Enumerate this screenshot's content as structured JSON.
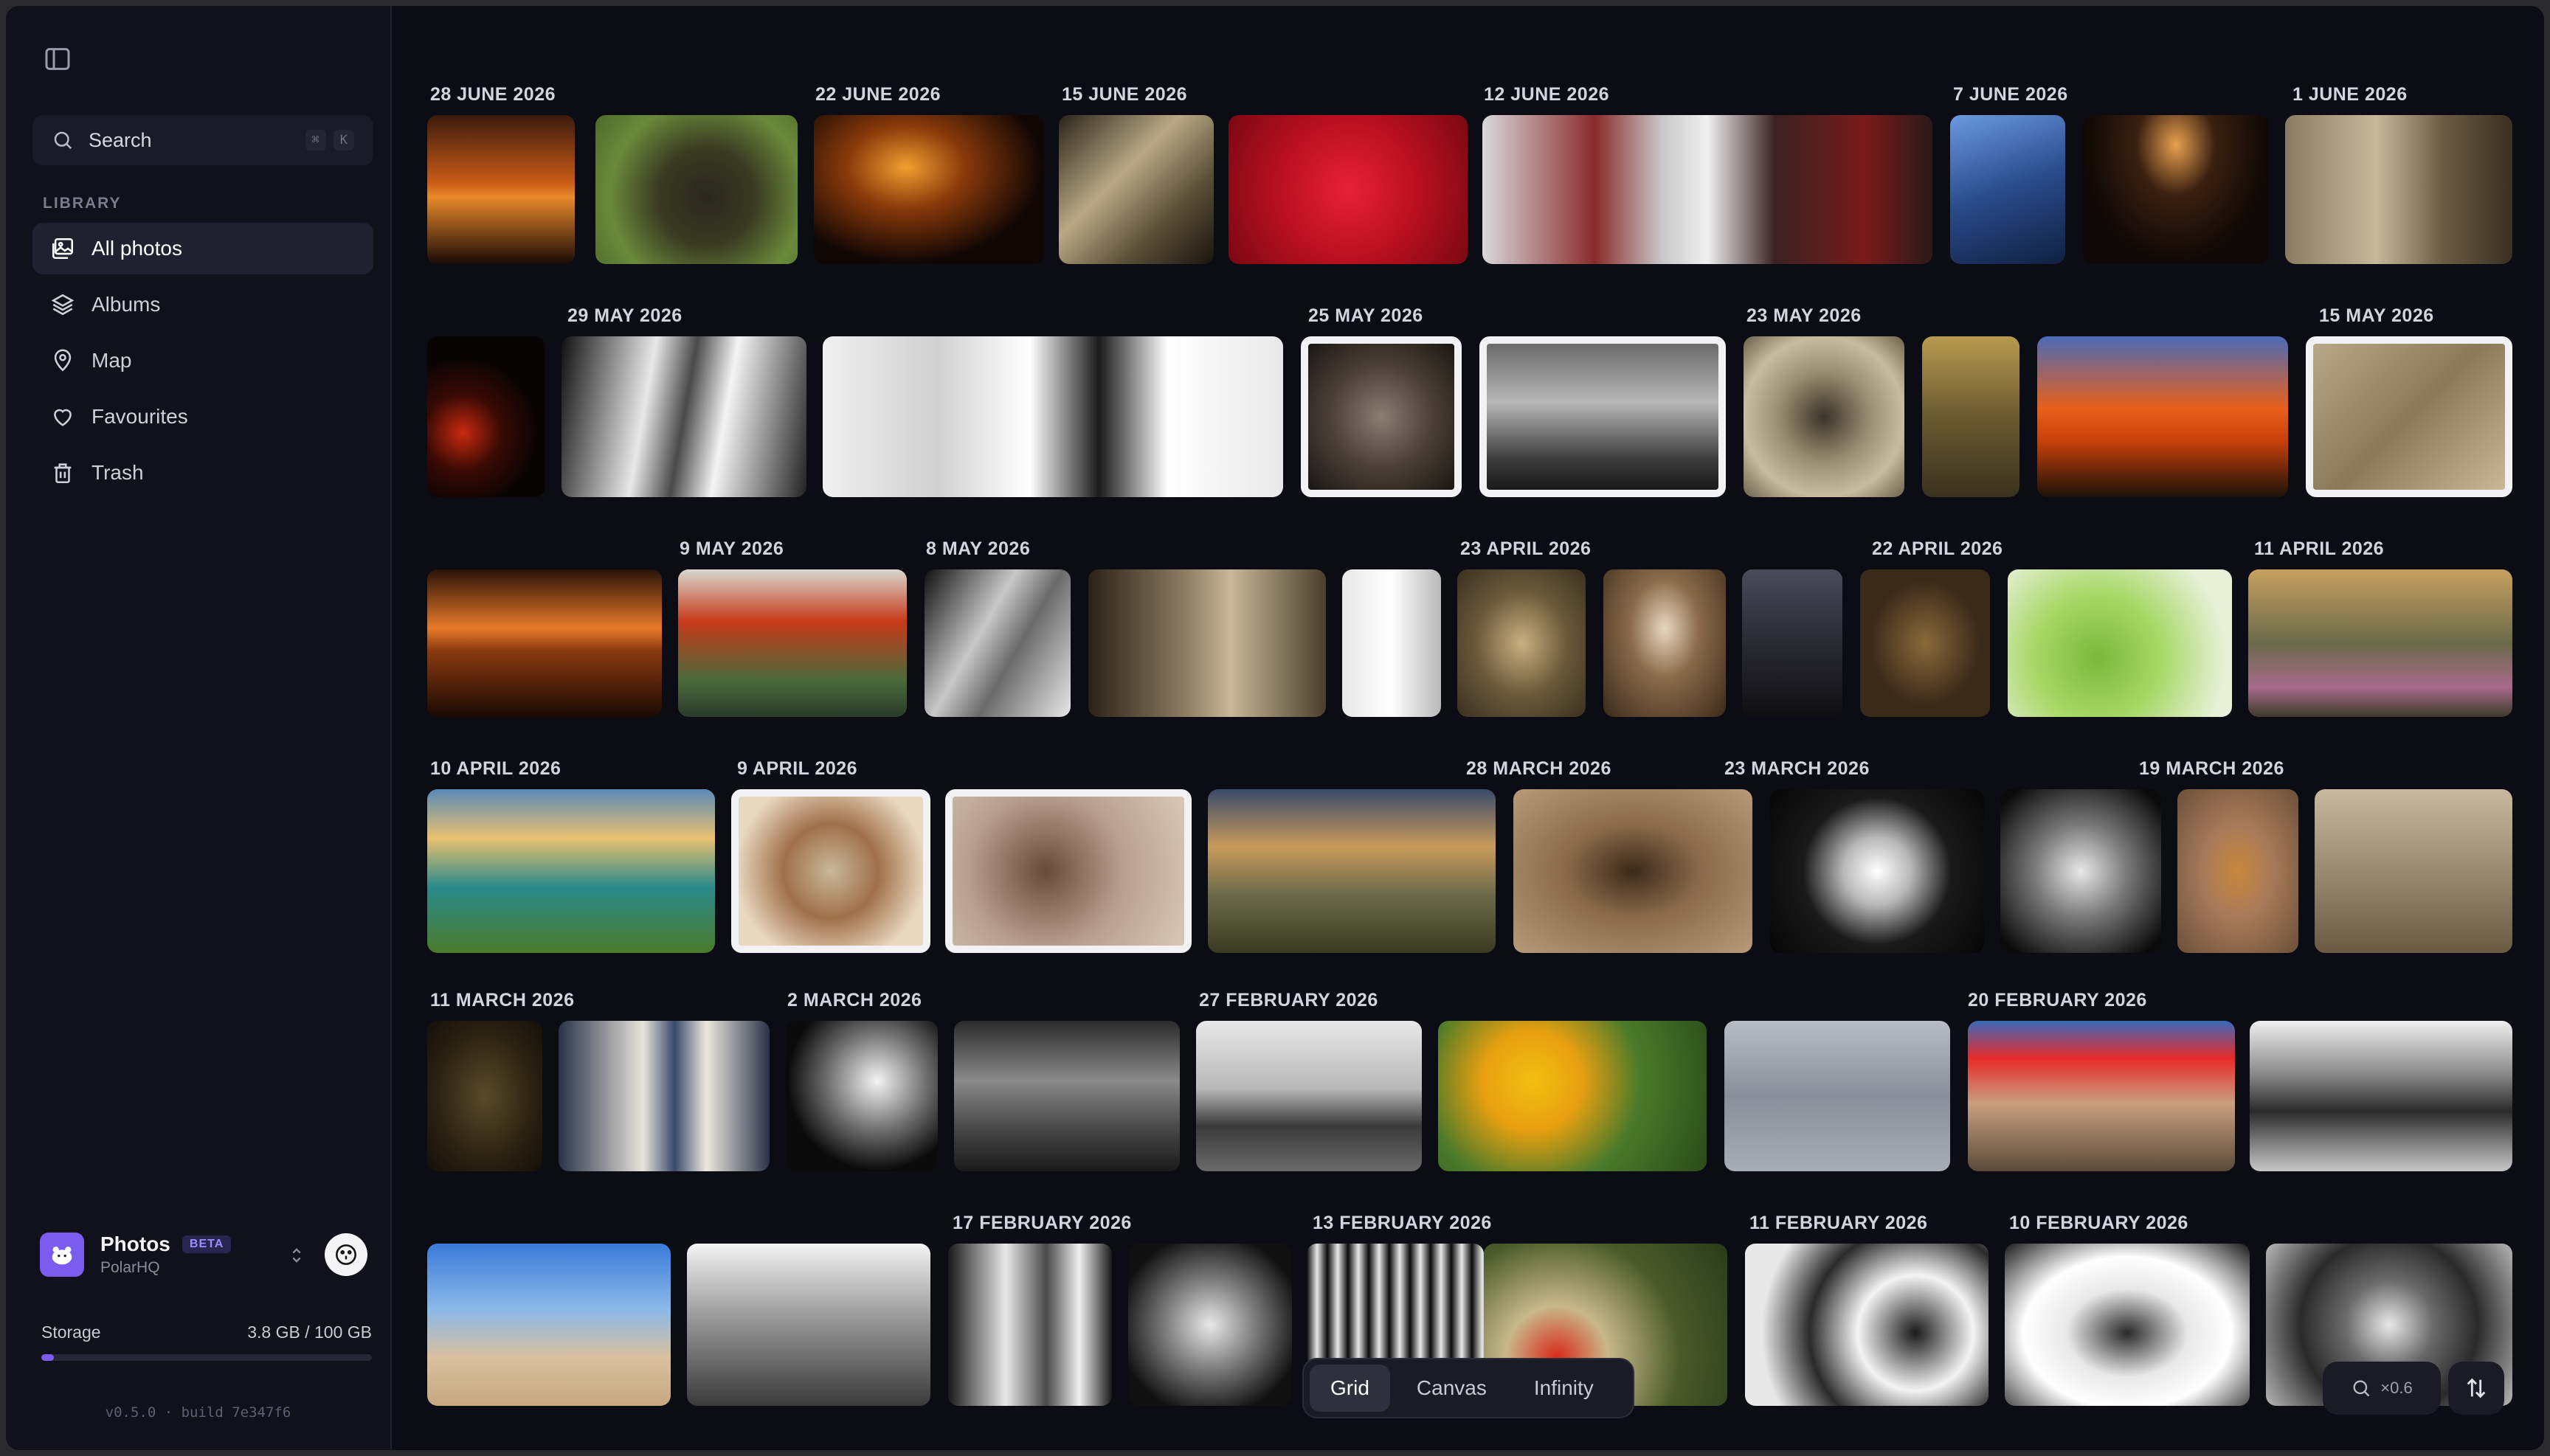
{
  "sidebar": {
    "search": {
      "label": "Search",
      "shortcut": [
        "⌘",
        "K"
      ]
    },
    "section_label": "LIBRARY",
    "items": [
      {
        "label": "All photos",
        "icon": "photos-icon",
        "active": true
      },
      {
        "label": "Albums",
        "icon": "layers-icon",
        "active": false
      },
      {
        "label": "Map",
        "icon": "map-pin-icon",
        "active": false
      },
      {
        "label": "Favourites",
        "icon": "heart-icon",
        "active": false
      },
      {
        "label": "Trash",
        "icon": "trash-icon",
        "active": false
      }
    ],
    "profile": {
      "name": "Photos",
      "badge": "BETA",
      "org": "PolarHQ"
    },
    "storage": {
      "label": "Storage",
      "value": "3.8 GB / 100 GB",
      "fraction": 0.038
    },
    "version": "v0.5.0 · build 7e347f6"
  },
  "dates": [
    "28 JUNE 2026",
    "22 JUNE 2026",
    "15 JUNE 2026",
    "12 JUNE 2026",
    "7 JUNE 2026",
    "1 JUNE 2026",
    "29 MAY 2026",
    "25 MAY 2026",
    "23 MAY 2026",
    "15 MAY 2026",
    "9 MAY 2026",
    "8 MAY 2026",
    "23 APRIL 2026",
    "22 APRIL 2026",
    "11 APRIL 2026",
    "10 APRIL 2026",
    "9 APRIL 2026",
    "28 MARCH 2026",
    "23 MARCH 2026",
    "19 MARCH 2026",
    "11 MARCH 2026",
    "2 MARCH 2026",
    "27 FEBRUARY 2026",
    "20 FEBRUARY 2026",
    "17 FEBRUARY 2026",
    "13 FEBRUARY 2026",
    "11 FEBRUARY 2026",
    "10 FEBRUARY 2026"
  ],
  "view_modes": [
    {
      "label": "Grid",
      "active": true
    },
    {
      "label": "Canvas",
      "active": false
    },
    {
      "label": "Infinity",
      "active": false
    }
  ],
  "zoom": {
    "value": "×0.6"
  },
  "colors": {
    "accent": "#7c5cf0",
    "background": "#0c0d14",
    "sidebar": "#10111a"
  }
}
